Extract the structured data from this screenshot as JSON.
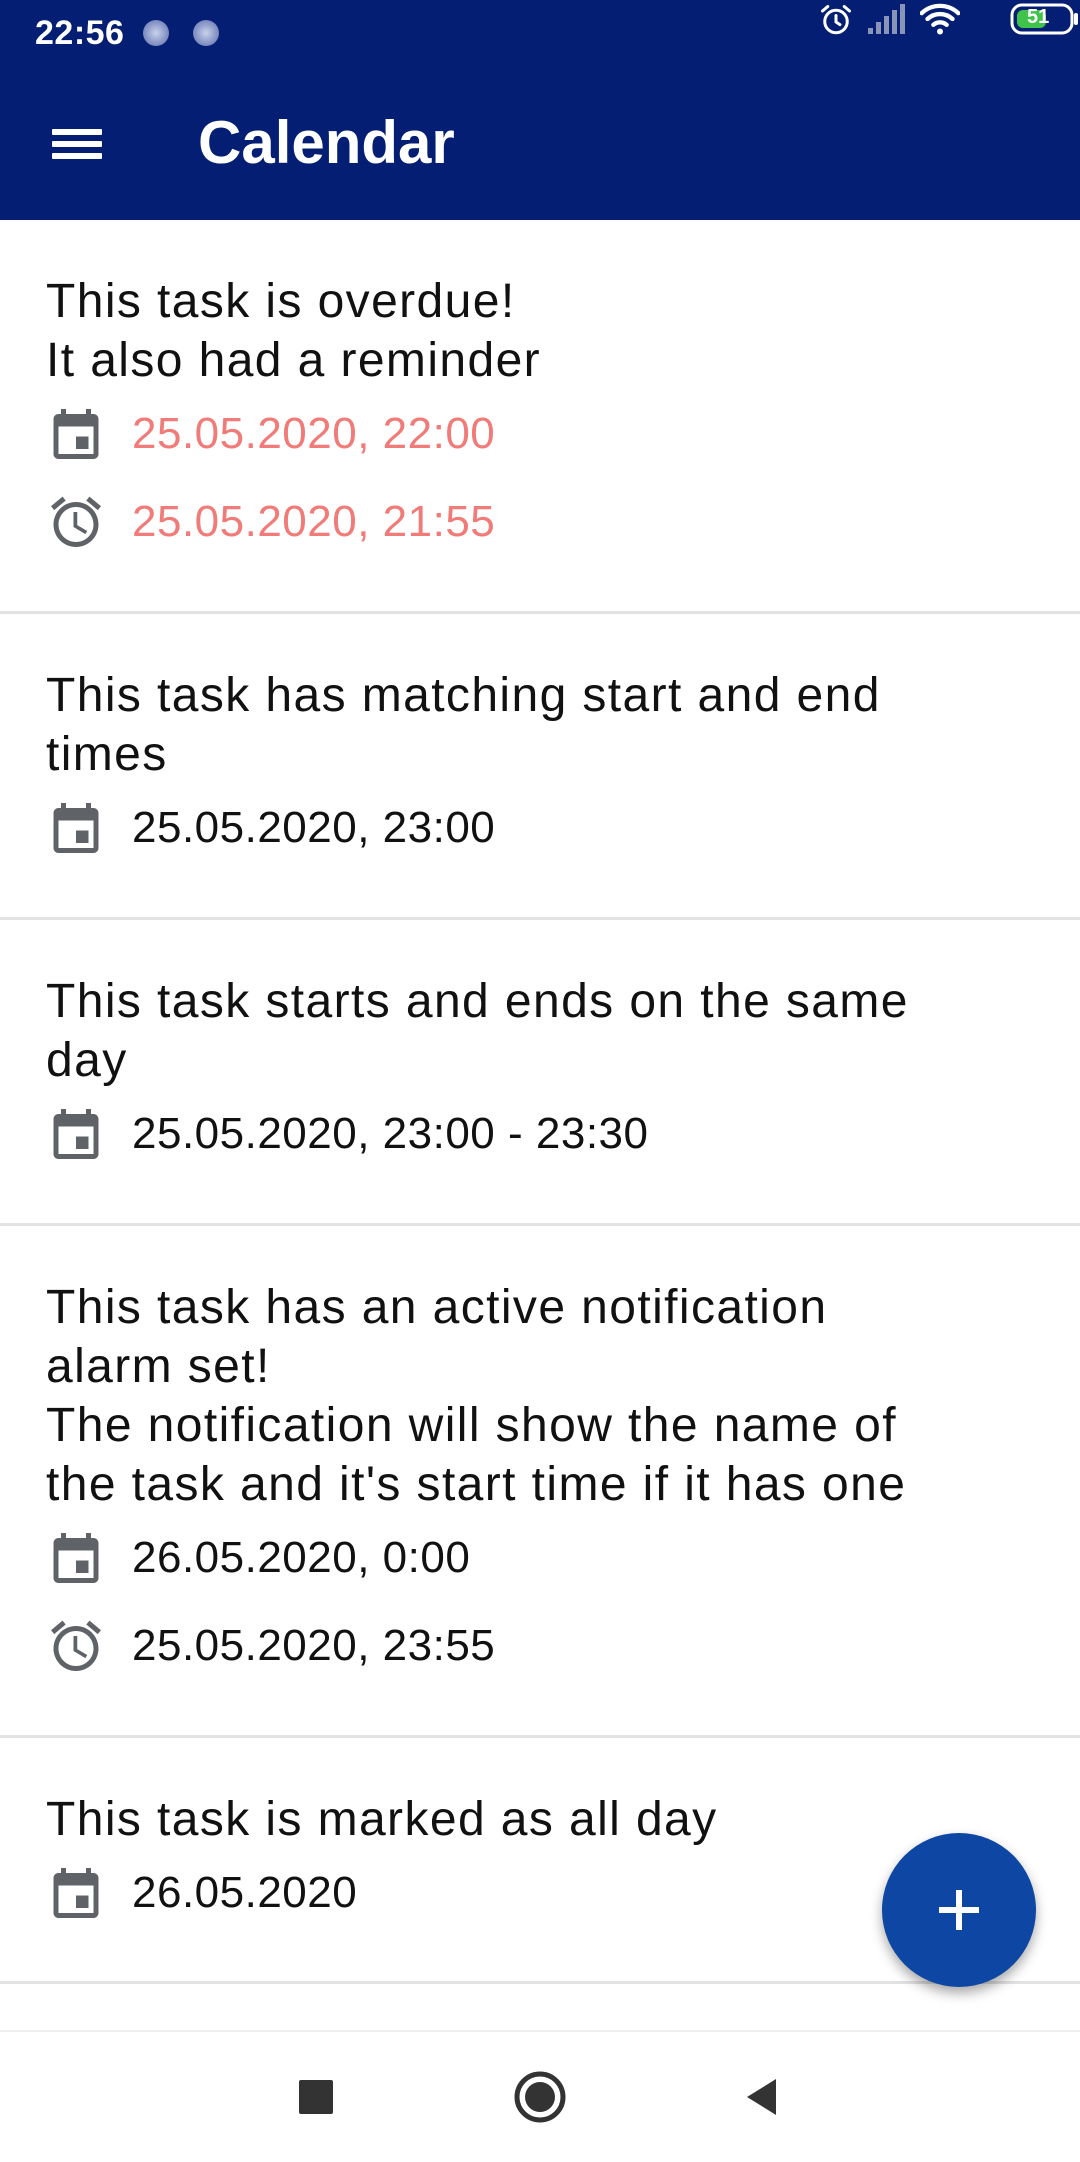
{
  "status_bar": {
    "time": "22:56",
    "battery": "51"
  },
  "app_bar": {
    "title": "Calendar"
  },
  "tasks": [
    {
      "title": "This task is overdue!\nIt also had a reminder",
      "date": "25.05.2020, 22:00",
      "reminder": "25.05.2020, 21:55"
    },
    {
      "title": "This task has matching start and end\ntimes",
      "date": "25.05.2020, 23:00"
    },
    {
      "title": "This task starts and ends on the same\nday",
      "date": "25.05.2020, 23:00 - 23:30"
    },
    {
      "title": "This task has an active notification\nalarm set!\nThe notification will show the name of\nthe task and it's start time if it has one",
      "date": "26.05.2020, 0:00",
      "reminder": "25.05.2020, 23:55"
    },
    {
      "title": "This task is marked as all day",
      "date": "26.05.2020"
    }
  ],
  "colors": {
    "app_bar": "#031E72",
    "fab": "#0E46A3",
    "overdue_text": "#F07B78",
    "icon_gray": "#5f6368"
  },
  "icons": {
    "menu": "hamburger-menu-icon",
    "date": "calendar-icon",
    "reminder": "alarm-clock-icon",
    "fab": "plus-icon"
  }
}
